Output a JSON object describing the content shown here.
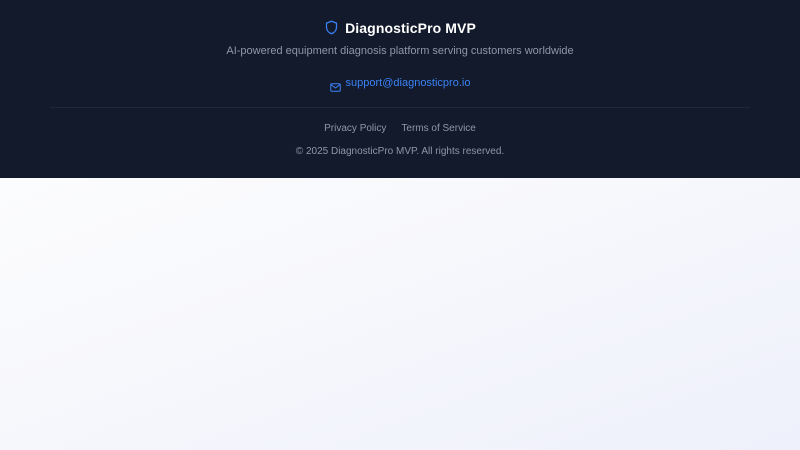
{
  "footer": {
    "brand": {
      "name": "DiagnosticPro MVP",
      "icon": "shield-icon"
    },
    "tagline": "AI-powered equipment diagnosis platform serving customers worldwide",
    "contact": {
      "icon": "mail-icon",
      "email": "support@diagnosticpro.io"
    },
    "links": {
      "privacy": "Privacy Policy",
      "terms": "Terms of Service"
    },
    "copyright": "© 2025 DiagnosticPro MVP. All rights reserved."
  },
  "colors": {
    "footer_bg": "#121a2b",
    "accent": "#3b82f6",
    "muted_text": "#8e97a8",
    "title_text": "#ffffff"
  }
}
